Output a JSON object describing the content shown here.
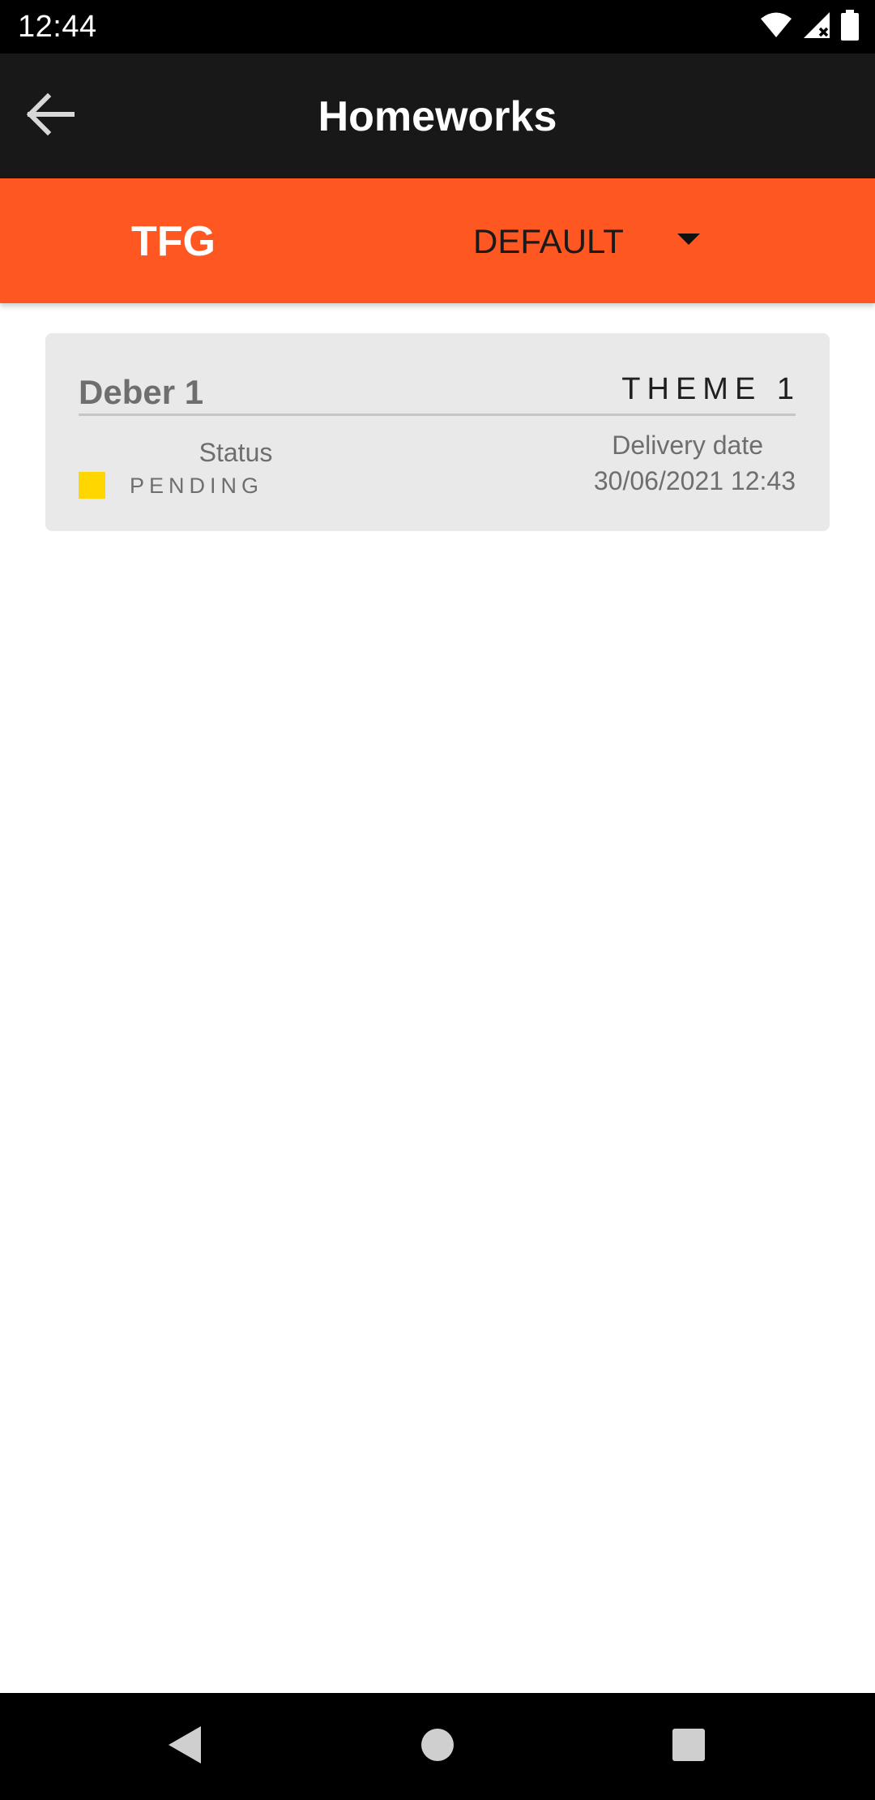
{
  "status_bar": {
    "time": "12:44",
    "icons": [
      "wifi-icon",
      "cell-signal-icon",
      "battery-icon"
    ]
  },
  "toolbar": {
    "back_icon": "arrow-left-icon",
    "title": "Homeworks"
  },
  "filter_bar": {
    "subject": "TFG",
    "group_selected": "DEFAULT",
    "dropdown_icon": "caret-down-icon",
    "background_color": "#ff5722"
  },
  "homeworks": [
    {
      "title": "Deber 1",
      "theme": "THEME 1",
      "status_label": "Status",
      "status_value": "PENDING",
      "status_color": "#ffd600",
      "delivery_label": "Delivery date",
      "delivery_date": "30/06/2021 12:43"
    }
  ],
  "nav_bar": {
    "icons": [
      "nav-back-icon",
      "nav-home-icon",
      "nav-recents-icon"
    ]
  }
}
